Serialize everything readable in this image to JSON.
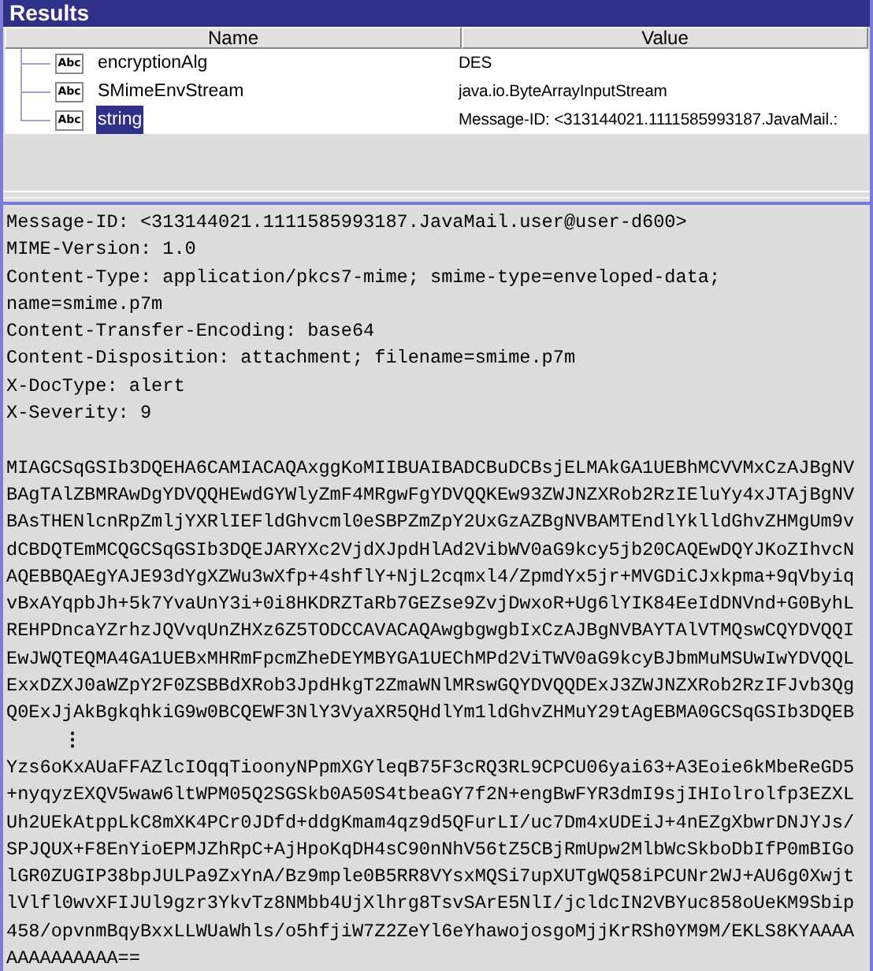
{
  "window": {
    "title": "Results"
  },
  "table": {
    "columns": [
      "Name",
      "Value"
    ],
    "rows": [
      {
        "icon_text": "Abc",
        "name": "encryptionAlg",
        "value": "DES",
        "selected": false
      },
      {
        "icon_text": "Abc",
        "name": "SMimeEnvStream",
        "value": "java.io.ByteArrayInputStream",
        "selected": false
      },
      {
        "icon_text": "Abc",
        "name": "string",
        "value": "Message-ID: <313144021.1111585993187.JavaMail.:",
        "selected": true
      }
    ]
  },
  "detail": {
    "headers": [
      "Message-ID: <313144021.1111585993187.JavaMail.user@user-d600>",
      "MIME-Version: 1.0",
      "Content-Type: application/pkcs7-mime; smime-type=enveloped-data;",
      "name=smime.p7m",
      "Content-Transfer-Encoding: base64",
      "Content-Disposition: attachment; filename=smime.p7m",
      "X-DocType: alert",
      "X-Severity: 9"
    ],
    "body_start": [
      "MIAGCSqGSIb3DQEHA6CAMIACAQAxggKoMIIBUAIBADCBuDCBsjELMAkGA1UEBhMCVVMxCzAJBgNV",
      "BAgTAlZBMRAwDgYDVQQHEwdGYWlyZmF4MRgwFgYDVQQKEw93ZWJNZXRob2RzIEluYy4xJTAjBgNV",
      "BAsTHENlcnRpZmljYXRlIEFldGhvcml0eSBPZmZpY2UxGzAZBgNVBAMTEndlYklldGhvZHMgUm9v",
      "dCBDQTEmMCQGCSqGSIb3DQEJARYXc2VjdXJpdHlAd2VibWV0aG9kcy5jb20CAQEwDQYJKoZIhvcN",
      "AQEBBQAEgYAJE93dYgXZWu3wXfp+4shflY+NjL2cqmxl4/ZpmdYx5jr+MVGDiCJxkpma+9qVbyiq",
      "vBxAYqpbJh+5k7YvaUnY3i+0i8HKDRZTaRb7GEZse9ZvjDwxoR+Ug6lYIK84EeIdDNVnd+G0ByhL",
      "REHPDncaYZrhzJQVvqUnZHXz6Z5TODCCAVACAQAwgbgwgbIxCzAJBgNVBAYTAlVTMQswCQYDVQQI",
      "EwJWQTEQMA4GA1UEBxMHRmFpcmZheDEYMBYGA1UEChMPd2ViTWV0aG9kcyBJbmMuMSUwIwYDVQQL",
      "ExxDZXJ0aWZpY2F0ZSBBdXRob3JpdHkgT2ZmaWNlMRswGQYDVQQDExJ3ZWJNZXRob2RzIFJvb3Qg",
      "Q0ExJjAkBgkqhkiG9w0BCQEWF3NlY3VyaXR5QHdlYm1ldGhvZHMuY29tAgEBMA0GCSqGSIb3DQEB"
    ],
    "gap_mark": "⋮",
    "body_end": [
      "Yzs6oKxAUaFFAZlcIOqqTioonyNPpmXGYleqB75F3cRQ3RL9CPCU06yai63+A3Eoie6kMbeReGD5",
      "+nyqyzEXQV5waw6ltWPM05Q2SGSkb0A50S4tbeaGY7f2N+engBwFYR3dmI9sjIHIolrolfp3EZXL",
      "Uh2UEkAtppLkC8mXK4PCr0JDfd+ddgKmam4qz9d5QFurLI/uc7Dm4xUDEiJ+4nEZgXbwrDNJYJs/",
      "SPJQUX+F8EnYioEPMJZhRpC+AjHpoKqDH4sC90nNhV56tZ5CBjRmUpw2MlbWcSkboDbIfP0mBIGo",
      "lGR0ZUGIP38bpJULPa9ZxYnA/Bz9mple0B5RR8VYsxMQSi7upXUTgWQ58iPCUNr2WJ+AU6g0Xwjt",
      "lVlfl0wvXFIJUl9gzr3YkvTz8NMbb4UjXlhrg8TsvSArE5NlI/jcldcIN2VBYuc858oUeKM9Sbip",
      "458/opvnmBqyBxxLLWUaWhls/o5hfjiW7Z2ZeYl6eYhawojosgoMjjKrRSh0YM9M/EKLS8KYAAAA",
      "AAAAAAAAAA=="
    ]
  }
}
